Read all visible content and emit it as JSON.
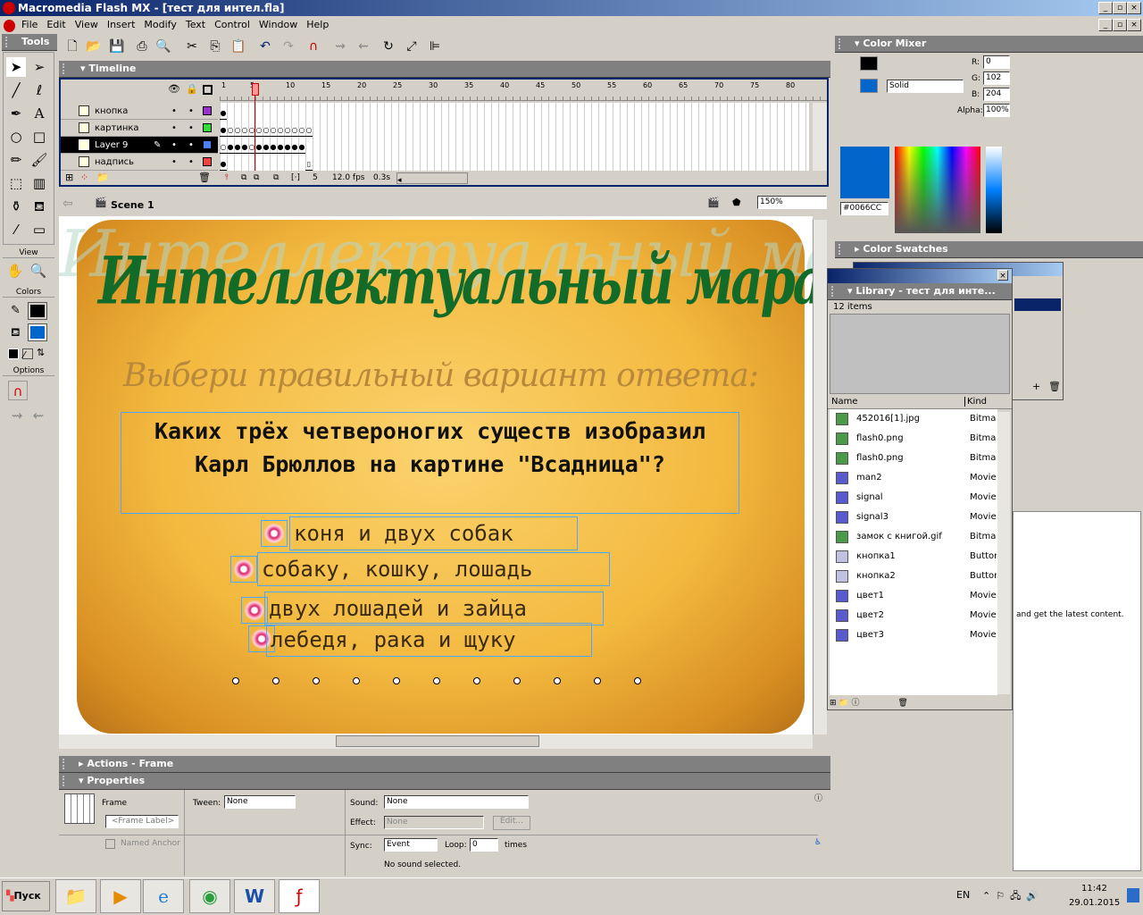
{
  "window": {
    "title": "Macromedia Flash MX - [тест для интел.fla]"
  },
  "menu": [
    "File",
    "Edit",
    "View",
    "Insert",
    "Modify",
    "Text",
    "Control",
    "Window",
    "Help"
  ],
  "tools": {
    "title": "Tools",
    "view_label": "View",
    "colors_label": "Colors",
    "options_label": "Options",
    "stroke_color": "#000000",
    "fill_color": "#0066CC"
  },
  "timeline": {
    "title": "Timeline",
    "frame_numbers": [
      "1",
      "5",
      "10",
      "15",
      "20",
      "25",
      "30",
      "35",
      "40",
      "45",
      "50",
      "55",
      "60",
      "65",
      "70",
      "75",
      "80"
    ],
    "layers": [
      {
        "name": "кнопка",
        "color": "#9933cc"
      },
      {
        "name": "картинка",
        "color": "#33dd33"
      },
      {
        "name": "Layer 9",
        "color": "#4d7fff"
      },
      {
        "name": "надпись",
        "color": "#ee4444"
      }
    ],
    "current_frame": "5",
    "fps": "12.0 fps",
    "time": "0.3s"
  },
  "scene": {
    "name": "Scene 1",
    "zoom": "150%"
  },
  "stage": {
    "watermark": "Интеллектуальный марафон",
    "title": "Интеллектуальный марафон",
    "subtitle": "Выбери правильный вариант ответа:",
    "question": "Каких трёх четвероногих существ изобразил Карл Брюллов на картине \"Всадница\"?",
    "answers": [
      "коня и двух собак",
      "собаку, кошку, лошадь",
      "двух лошадей и зайца",
      "лебедя, рака и щуку"
    ]
  },
  "actions": {
    "title": "Actions - Frame"
  },
  "properties": {
    "title": "Properties",
    "frame_label": "Frame",
    "frame_label_placeholder": "<Frame Label>",
    "tween_label": "Tween:",
    "tween_value": "None",
    "sound_label": "Sound:",
    "sound_value": "None",
    "effect_label": "Effect:",
    "effect_value": "None",
    "edit_label": "Edit...",
    "named_anchor": "Named Anchor",
    "sync_label": "Sync:",
    "sync_value": "Event",
    "loop_label": "Loop:",
    "loop_value": "0",
    "times_label": "times",
    "status": "No sound selected."
  },
  "color_mixer": {
    "title": "Color Mixer",
    "r_label": "R:",
    "r": "0",
    "g_label": "G:",
    "g": "102",
    "b_label": "B:",
    "b": "204",
    "alpha_label": "Alpha:",
    "alpha": "100%",
    "fill_type": "Solid",
    "hex": "#0066CC"
  },
  "color_swatches": {
    "title": "Color Swatches"
  },
  "library": {
    "title": "Library - тест для инте...",
    "count": "12 items",
    "col_name": "Name",
    "col_kind": "Kind",
    "items": [
      {
        "name": "452016[1].jpg",
        "kind": "Bitmap",
        "icon": "bitmap"
      },
      {
        "name": "flash0.png",
        "kind": "Bitmap",
        "icon": "bitmap"
      },
      {
        "name": "flash0.png",
        "kind": "Bitmap",
        "icon": "bitmap"
      },
      {
        "name": "man2",
        "kind": "Movie",
        "icon": "movie"
      },
      {
        "name": "signal",
        "kind": "Movie",
        "icon": "movie"
      },
      {
        "name": "signal3",
        "kind": "Movie",
        "icon": "movie"
      },
      {
        "name": "замок с книгой.gif",
        "kind": "Bitmap",
        "icon": "bitmap"
      },
      {
        "name": "кнопка1",
        "kind": "Button",
        "icon": "button"
      },
      {
        "name": "кнопка2",
        "kind": "Button",
        "icon": "button"
      },
      {
        "name": "цвет1",
        "kind": "Movie",
        "icon": "movie"
      },
      {
        "name": "цвет2",
        "kind": "Movie",
        "icon": "movie"
      },
      {
        "name": "цвет3",
        "kind": "Movie",
        "icon": "movie"
      }
    ]
  },
  "answers_panel": {
    "text": "and get the latest content."
  },
  "taskbar": {
    "start": "Пуск",
    "lang": "EN",
    "time": "11:42",
    "date": "29.01.2015"
  }
}
